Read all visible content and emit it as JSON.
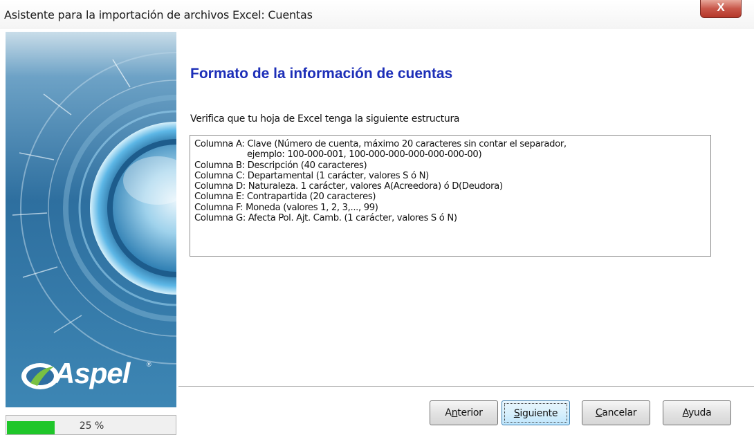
{
  "window": {
    "title": "Asistente para la importación de archivos Excel: Cuentas",
    "close_glyph": "X"
  },
  "sidebar": {
    "logo_text": "Aspel",
    "logo_mark": "®",
    "background_color": "#2f6fa1"
  },
  "progress": {
    "percent": 25,
    "label": "25 %",
    "color": "#1fc62a"
  },
  "main": {
    "heading": "Formato de la información de cuentas",
    "subtitle": "Verifica que tu hoja de Excel tenga la siguiente estructura",
    "lines": [
      "Columna A: Clave (Número de cuenta, máximo 20 caracteres sin contar el separador,",
      "ejemplo: 100-000-001, 100-000-000-000-000-000-00)",
      "Columna B: Descripción (40 caracteres)",
      "Columna C: Departamental (1 carácter, valores S ó N)",
      "Columna D: Naturaleza. 1 carácter, valores A(Acreedora) ó D(Deudora)",
      "Columna E: Contrapartida (20 caracteres)",
      "Columna F: Moneda (valores 1, 2, 3,..., 99)",
      "Columna G: Afecta Pol. Ajt. Camb. (1 carácter, valores S ó N)"
    ]
  },
  "buttons": {
    "back": {
      "pre": "A",
      "mnemonic": "n",
      "post": "terior"
    },
    "next": {
      "pre": "",
      "mnemonic": "S",
      "post": "iguiente"
    },
    "cancel": {
      "pre": "",
      "mnemonic": "C",
      "post": "ancelar"
    },
    "help": {
      "pre": "",
      "mnemonic": "A",
      "post": "yuda"
    }
  }
}
